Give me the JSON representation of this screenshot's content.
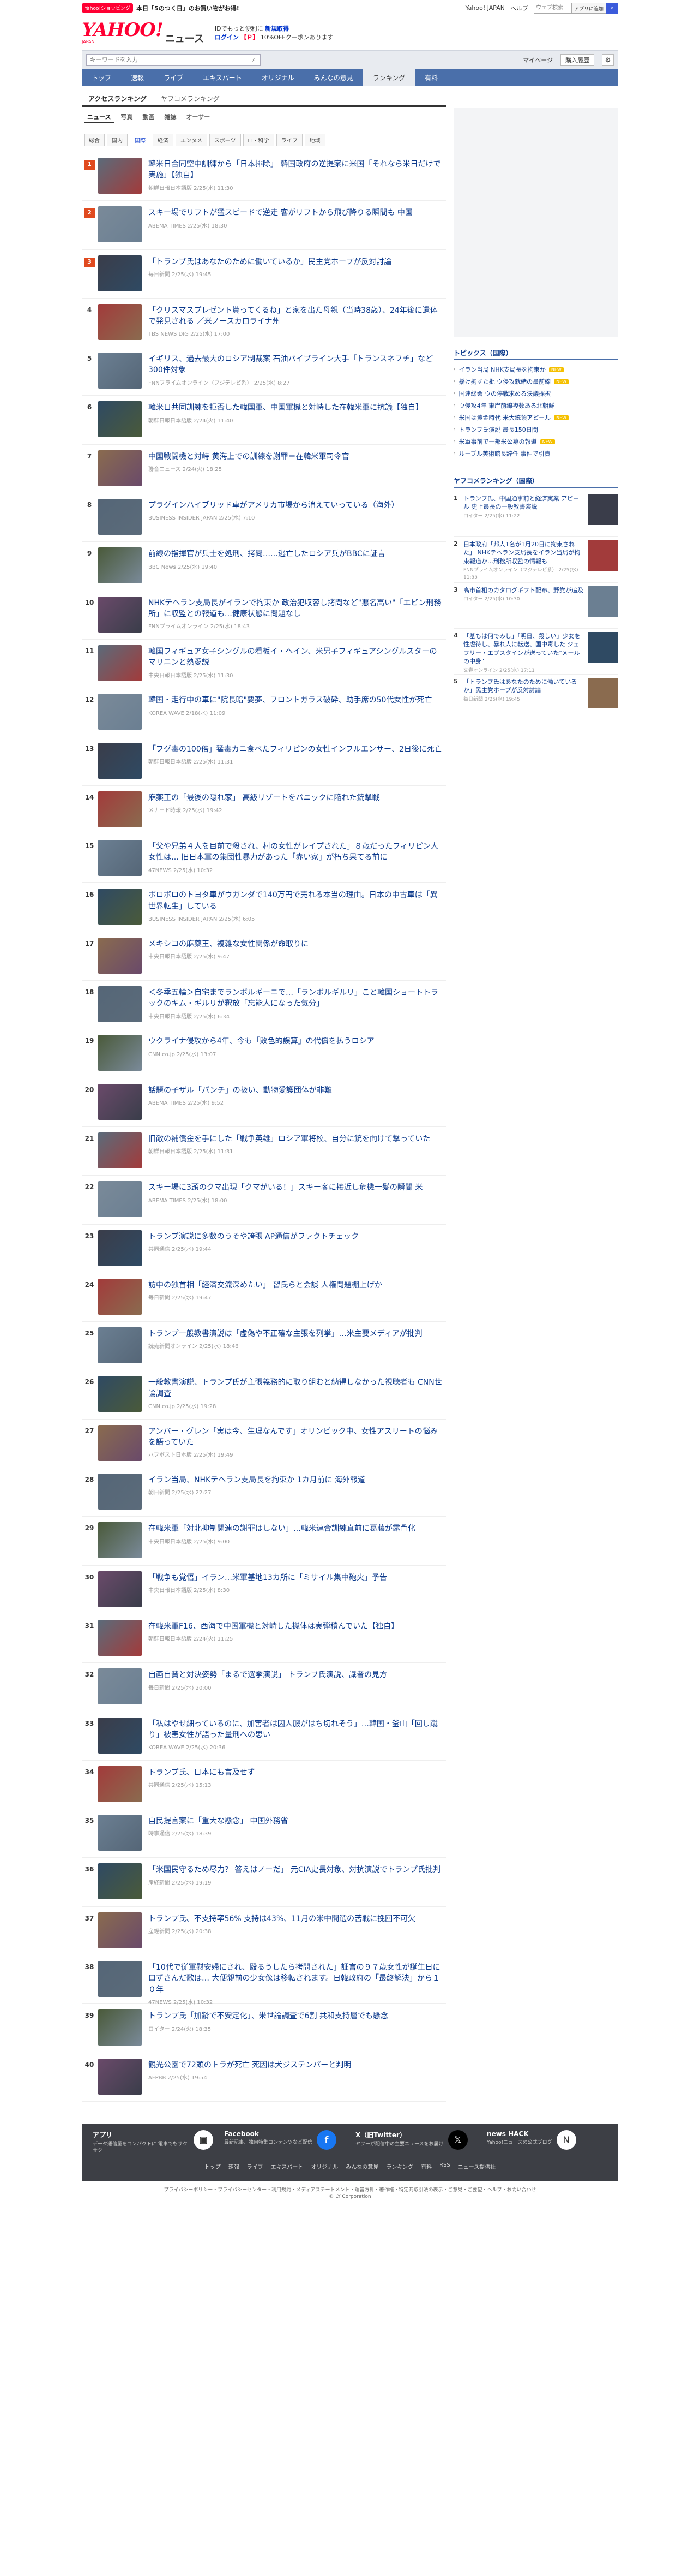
{
  "promo": {
    "badge": "Yahoo!ショッピング",
    "text": "本日「5のつく日」のお買い物がお得!"
  },
  "toplinks": {
    "yahoo_japan": "Yahoo! JAPAN",
    "help": "ヘルプ",
    "search_placeholder": "ウェブ検索",
    "search_select": "アプリに追加",
    "go_icon": "search-icon"
  },
  "header": {
    "logo": "YAHOO!",
    "logo_sub": "JAPAN",
    "section": "ニュース",
    "login_line1_a": "IDでもっと便利に",
    "login_line1_b": "新規取得",
    "login_line2_a": "ログイン",
    "login_line2_b": "【Ｐ】",
    "login_line2_c": "10%OFFクーポンあります"
  },
  "search": {
    "placeholder": "キーワードを入力",
    "mypage": "マイページ",
    "purchase": "購入履歴"
  },
  "gnav": [
    "トップ",
    "速報",
    "ライブ",
    "エキスパート",
    "オリジナル",
    "みんなの意見",
    "ランキング",
    "有料"
  ],
  "gnav_active": "ランキング",
  "tabs1": [
    "アクセスランキング",
    "ヤフコメランキング"
  ],
  "tabs2": [
    "ニュース",
    "写真",
    "動画",
    "雑誌",
    "オーサー"
  ],
  "tabs3": [
    "総合",
    "国内",
    "国際",
    "経済",
    "エンタメ",
    "スポーツ",
    "IT・科学",
    "ライフ",
    "地域"
  ],
  "tabs3_active": "国際",
  "ranking": [
    {
      "rank": "1",
      "title": "韓米日合同空中訓練から「日本排除」 韓国政府の逆提案に米国「それなら米日だけで実施」【独自】",
      "meta": "朝鮮日報日本語版 2/25(水) 11:30"
    },
    {
      "rank": "2",
      "title": "スキー場でリフトが猛スピードで逆走 客がリフトから飛び降りる瞬間も 中国",
      "meta": "ABEMA TIMES 2/25(水) 18:30"
    },
    {
      "rank": "3",
      "title": "「トランプ氏はあなたのために働いているか」民主党ホープが反対討論",
      "meta": "毎日新聞 2/25(水) 19:45"
    },
    {
      "rank": "4",
      "title": "「クリスマスプレゼント貰ってくるね」と家を出た母親（当時38歳）、24年後に遺体で発見される ／米ノースカロライナ州",
      "meta": "TBS NEWS DIG 2/25(水) 17:00"
    },
    {
      "rank": "5",
      "title": "イギリス、過去最大のロシア制裁案 石油パイプライン大手「トランスネフチ」など300件対象",
      "meta": "FNNプライムオンライン（フジテレビ系） 2/25(水) 8:27"
    },
    {
      "rank": "6",
      "title": "韓米日共同訓練を拒否した韓国軍、中国軍機と対峙した在韓米軍に抗議【独自】",
      "meta": "朝鮮日報日本語版 2/24(火) 11:40"
    },
    {
      "rank": "7",
      "title": "中国戦闘機と対峙 黄海上での訓練を謝罪＝在韓米軍司令官",
      "meta": "聯合ニュース 2/24(火) 18:25"
    },
    {
      "rank": "8",
      "title": "プラグインハイブリッド車がアメリカ市場から消えていっている（海外）",
      "meta": "BUSINESS INSIDER JAPAN 2/25(水) 7:10"
    },
    {
      "rank": "9",
      "title": "前線の指揮官が兵士を処刑、拷問……逃亡したロシア兵がBBCに証言",
      "meta": "BBC News 2/25(水) 19:40"
    },
    {
      "rank": "10",
      "title": "NHKテヘラン支局長がイランで拘束か 政治犯収容し拷問など\"悪名高い\"「エビン刑務所」に収監との報道も…健康状態に問題なし",
      "meta": "FNNプライムオンライン 2/25(水) 18:43"
    },
    {
      "rank": "11",
      "title": "韓国フィギュア女子シングルの看板イ・ヘイン、米男子フィギュアシングルスターのマリニンと熱愛説",
      "meta": "中央日報日本語版 2/25(水) 11:30"
    },
    {
      "rank": "12",
      "title": "韓国・走行中の車に\"院長暗\"要夢、フロントガラス破砕、助手席の50代女性が死亡",
      "meta": "KOREA WAVE 2/18(水) 11:09"
    },
    {
      "rank": "13",
      "title": "「フグ毒の100倍」猛毒カニ食べたフィリピンの女性インフルエンサー、2日後に死亡",
      "meta": "朝鮮日報日本語版 2/25(水) 11:31"
    },
    {
      "rank": "14",
      "title": "麻薬王の「最後の隠れ家」 高級リゾートをパニックに陥れた銃撃戦",
      "meta": "メナード時報 2/25(水) 19:42"
    },
    {
      "rank": "15",
      "title": "「父や兄弟４人を目前で殺され、村の女性がレイプされた」８歳だったフィリピン人女性は… 旧日本軍の集団性暴力があった「赤い家」が朽ち果てる前に",
      "meta": "47NEWS 2/25(水) 10:32"
    },
    {
      "rank": "16",
      "title": "ボロボロのトヨタ車がウガンダで140万円で売れる本当の理由。日本の中古車は「異世界転生」している",
      "meta": "BUSINESS INSIDER JAPAN 2/25(水) 6:05"
    },
    {
      "rank": "17",
      "title": "メキシコの麻薬王、複雑な女性関係が命取りに",
      "meta": "中央日報日本語版 2/25(水) 9:47"
    },
    {
      "rank": "18",
      "title": "＜冬季五輪＞自宅までランボルギーニで…「ランボルギルリ」こと韓国ショートトラックのキム・ギルリが釈放「忘能人になった気分」",
      "meta": "中央日報日本語版 2/25(水) 6:34"
    },
    {
      "rank": "19",
      "title": "ウクライナ侵攻から4年、今も「敗色的誤算」の代償を払うロシア",
      "meta": "CNN.co.jp 2/25(水) 13:07"
    },
    {
      "rank": "20",
      "title": "話題の子ザル「パンチ」の扱い、動物愛護団体が非難",
      "meta": "ABEMA TIMES 2/25(水) 9:52"
    },
    {
      "rank": "21",
      "title": "旧敵の補償金を手にした「戦争英雄」ロシア軍将校、自分に銃を向けて撃っていた",
      "meta": "朝鮮日報日本語版 2/25(水) 11:31"
    },
    {
      "rank": "22",
      "title": "スキー場に3頭のクマ出現「クマがいる！」スキー客に接近し危機一髪の瞬間 米",
      "meta": "ABEMA TIMES 2/25(水) 18:00"
    },
    {
      "rank": "23",
      "title": "トランプ演説に多数のうそや誇張 AP通信がファクトチェック",
      "meta": "共同通信 2/25(水) 19:44"
    },
    {
      "rank": "24",
      "title": "訪中の独首相「経済交流深めたい」 習氏らと会談 人権問題棚上げか",
      "meta": "毎日新聞 2/25(水) 19:47"
    },
    {
      "rank": "25",
      "title": "トランプ一般教書演説は「虚偽や不正確な主張を列挙」…米主要メディアが批判",
      "meta": "読売新聞オンライン 2/25(水) 18:46"
    },
    {
      "rank": "26",
      "title": "一般教書演説、トランプ氏が主張義務的に取り組むと納得しなかった視聴者も CNN世論調査",
      "meta": "CNN.co.jp 2/25(水) 19:28"
    },
    {
      "rank": "27",
      "title": "アンバー・グレン「実は今、生理なんです」オリンピック中、女性アスリートの悩みを語っていた",
      "meta": "ハフポスト日本版 2/25(水) 19:49"
    },
    {
      "rank": "28",
      "title": "イラン当局、NHKテヘラン支局長を拘束か 1カ月前に 海外報道",
      "meta": "朝日新聞 2/25(水) 22:27"
    },
    {
      "rank": "29",
      "title": "在韓米軍「対北抑制関連の謝罪はしない」…韓米連合訓練直前に葛藤が露骨化",
      "meta": "中央日報日本語版 2/25(水) 9:00"
    },
    {
      "rank": "30",
      "title": "「戦争も覚悟」イラン…米軍基地13カ所に「ミサイル集中砲火」予告",
      "meta": "中央日報日本語版 2/25(水) 8:30"
    },
    {
      "rank": "31",
      "title": "在韓米軍F16、西海で中国軍機と対峙した機体は実弾積んでいた【独自】",
      "meta": "朝鮮日報日本語版 2/24(火) 11:25"
    },
    {
      "rank": "32",
      "title": "自画自賛と対決姿勢「まるで選挙演説」 トランプ氏演説、識者の見方",
      "meta": "毎日新聞 2/25(水) 20:00"
    },
    {
      "rank": "33",
      "title": "「私はやせ細っているのに、加害者は囚人服がはち切れそう」…韓国・釜山「回し蹴り」被害女性が語った量刑への思い",
      "meta": "KOREA WAVE 2/25(水) 20:36"
    },
    {
      "rank": "34",
      "title": "トランプ氏、日本にも言及せず",
      "meta": "共同通信 2/25(水) 15:13"
    },
    {
      "rank": "35",
      "title": "自民提言案に「重大な懸念」 中国外務省",
      "meta": "時事通信 2/25(水) 18:39"
    },
    {
      "rank": "36",
      "title": "「米国民守るため尽力？ 答えはノーだ」 元CIA史長対象、対抗演説でトランプ氏批判",
      "meta": "産経新聞 2/25(水) 19:19"
    },
    {
      "rank": "37",
      "title": "トランプ氏、不支持率56% 支持は43%、11月の米中間選の苦戦に挽回不可欠",
      "meta": "産経新聞 2/25(水) 20:38"
    },
    {
      "rank": "38",
      "title": "「10代で従軍慰安婦にされ、殴るうしたら拷問された」証言の９７歳女性が誕生日に口ずさんだ歌は… 大便親前の少女像は移転されます。日韓政府の「最終解決」から１０年",
      "meta": "47NEWS 2/25(水) 10:32"
    },
    {
      "rank": "39",
      "title": "トランプ氏「加齢で不安定化」、米世論調査で6割 共和支持層でも懸念",
      "meta": "ロイター 2/24(火) 18:35"
    },
    {
      "rank": "40",
      "title": "観光公園で72頭のトラが死亡 死因は犬ジステンパーと判明",
      "meta": "AFPBB 2/25(水) 19:54"
    }
  ],
  "topics": {
    "heading": "トピックス（国際）",
    "items": [
      {
        "text": "イラン当局 NHK支局長を拘束か",
        "new": "NEW"
      },
      {
        "text": "揺け拘ずた批 ウ侵攻就緒の最前線",
        "new": "NEW"
      },
      {
        "text": "国連総会 ウの停戦求める決議採択",
        "new": ""
      },
      {
        "text": "ウ侵攻4年 東岸前線複数ある北朝鮮",
        "new": ""
      },
      {
        "text": "米国は黄金時代 米大統領アピール",
        "new": "NEW"
      },
      {
        "text": "トランプ氏演説 最長150日間",
        "new": ""
      },
      {
        "text": "米軍事前で一部米公募の報道",
        "new": "NEW"
      },
      {
        "text": "ルーブル美術館長辞任 事件で引責",
        "new": ""
      }
    ]
  },
  "yafucome": {
    "heading": "ヤフコメランキング（国際）",
    "items": [
      {
        "rank": "1",
        "title": "トランプ氏、中国通事前と経済実業 アピール 史上最長の一般教書演説",
        "meta": "ロイター 2/25(水) 11:22"
      },
      {
        "rank": "2",
        "title": "日本政府「邦人1名が1月20日に拘束された」 NHKテヘラン支局長をイラン当局が拘束報道か…刑務所収監の情報も",
        "meta": "FNNプライムオンライン（フジテレビ系） 2/25(水) 11:55"
      },
      {
        "rank": "3",
        "title": "高市首相のカタログギフト配布、野党が追及",
        "meta": "ロイター 2/25(水) 10:30"
      },
      {
        "rank": "4",
        "title": "「基もは何でみし」「明日、殺しい」少女を性虐待し、暴れ人に転送、国中毒した ジェフリー・エプスタインが送っていた\"メールの中身\"",
        "meta": "文春オンライン 2/25(水) 17:11"
      },
      {
        "rank": "5",
        "title": "「トランプ氏はあなたのために働いているか」民主党ホープが反対討論",
        "meta": "毎日新聞 2/25(水) 19:45"
      }
    ]
  },
  "footer": {
    "apps": [
      {
        "icon": "app-icon",
        "title": "アプリ",
        "desc": "データ通信量をコンパクトに 電車でもサクサク"
      },
      {
        "icon": "facebook-icon",
        "title": "Facebook",
        "desc": "最新記事、独自特集コンテンツなど配信"
      },
      {
        "icon": "x-icon",
        "title": "X（旧Twitter）",
        "desc": "ヤフーが配信中の主要ニュースをお届け"
      },
      {
        "icon": "news-hack-icon",
        "title": "news HACK",
        "desc": "Yahoo!ニュースの公式ブログ"
      }
    ],
    "nav": [
      "トップ",
      "速報",
      "ライブ",
      "エキスパート",
      "オリジナル",
      "みんなの意見",
      "ランキング",
      "有料",
      "RSS",
      "ニュース提供社"
    ],
    "legal": "プライバシーポリシー・プライバシーセンター・利用規約・メディアステートメント・運営方針・著作権・特定商取引法の表示・ご意見・ご要望・ヘルプ・お問い合わせ",
    "copyright": "© LY Corporation"
  }
}
